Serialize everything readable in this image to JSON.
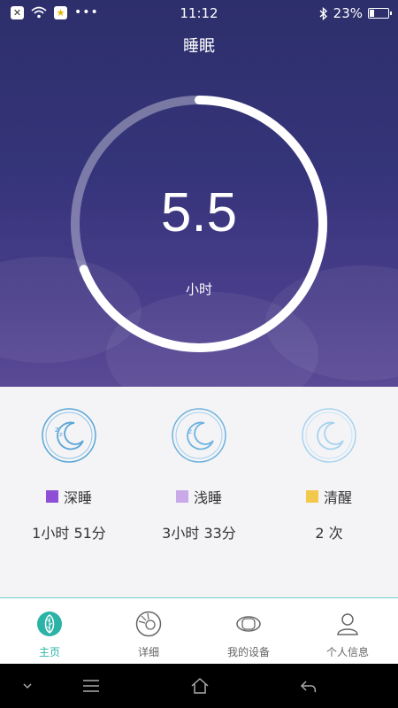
{
  "status_bar": {
    "time": "11:12",
    "battery": "23%",
    "battery_level": 0.23,
    "icons": [
      "close-notification-icon",
      "wifi-icon",
      "star-app-icon",
      "more-dots-icon",
      "bluetooth-icon",
      "battery-icon"
    ]
  },
  "header": {
    "title": "睡眠"
  },
  "summary": {
    "hours_value": "5.5",
    "unit": "小时",
    "progress_fraction": 0.69
  },
  "stats": [
    {
      "label": "深睡",
      "value": "1小时 51分",
      "color": "#8e4fd6"
    },
    {
      "label": "浅睡",
      "value": "3小时 33分",
      "color": "#c9a9e8"
    },
    {
      "label": "清醒",
      "value": "2 次",
      "color": "#f2c94c"
    }
  ],
  "tabs": [
    {
      "label": "主页",
      "icon": "home-leaf-icon",
      "active": true
    },
    {
      "label": "详细",
      "icon": "detail-chart-icon",
      "active": false
    },
    {
      "label": "我的设备",
      "icon": "device-band-icon",
      "active": false
    },
    {
      "label": "个人信息",
      "icon": "profile-icon",
      "active": false
    }
  ],
  "colors": {
    "accent": "#2bb3a6",
    "hero_top": "#2d2f6b",
    "hero_bottom": "#5a4a96"
  }
}
